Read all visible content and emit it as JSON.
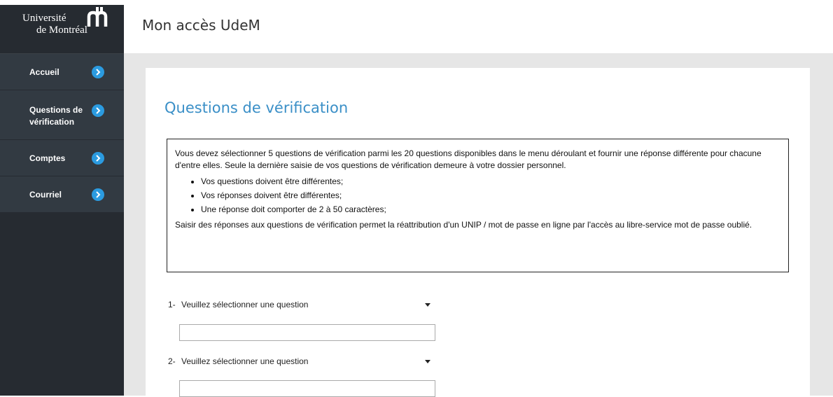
{
  "header": {
    "title": "Mon accès UdeM"
  },
  "logo": {
    "line1": "Université",
    "line2": "de Montréal"
  },
  "sidebar": {
    "items": [
      {
        "label": "Accueil"
      },
      {
        "label_line1": "Questions de",
        "label_line2": "vérification"
      },
      {
        "label": "Comptes"
      },
      {
        "label": "Courriel"
      }
    ]
  },
  "main": {
    "title": "Questions de vérification",
    "info": {
      "intro": "Vous devez sélectionner 5 questions de vérification parmi les 20 questions disponibles dans le menu déroulant et fournir une réponse différente pour chacune d'entre elles. Seule la dernière saisie de vos questions de vérification demeure à votre dossier personnel.",
      "rules": [
        "Vos questions doivent être différentes;",
        "Vos réponses doivent être différentes;",
        "Une réponse doit comporter de 2 à 50 caractères;"
      ],
      "footer": "Saisir des réponses aux questions de vérification permet la réattribution d'un UNIP / mot de passe en ligne par l'accès au libre-service mot de passe oublié."
    },
    "questions": [
      {
        "number": "1-",
        "select_value": "Veuillez sélectionner une question",
        "answer": ""
      },
      {
        "number": "2-",
        "select_value": "Veuillez sélectionner une question",
        "answer": ""
      }
    ]
  },
  "colors": {
    "sidebar_bg": "#262b31",
    "nav_item_bg": "#323a42",
    "accent": "#2b9be0",
    "title_blue": "#3a8fc7",
    "content_bg": "#e6e6e6"
  }
}
